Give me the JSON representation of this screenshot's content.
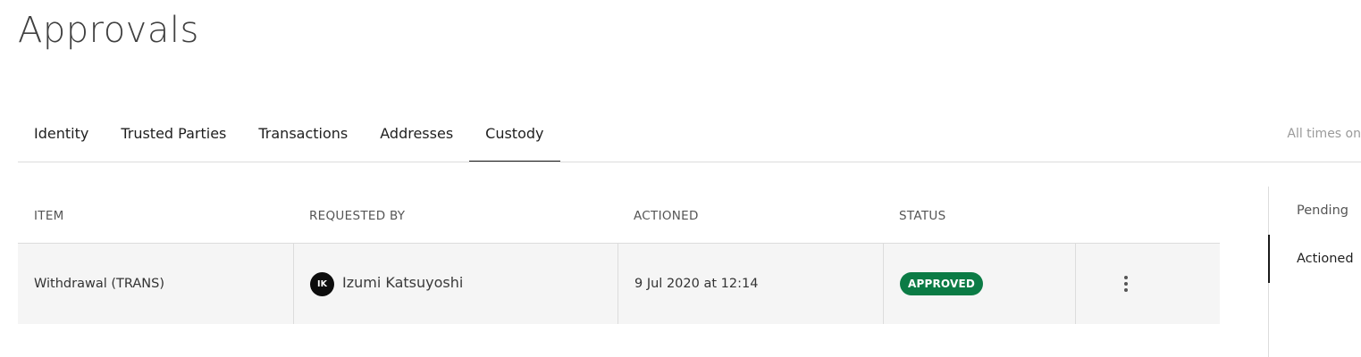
{
  "page": {
    "title": "Approvals"
  },
  "tabs": [
    {
      "label": "Identity",
      "active": false
    },
    {
      "label": "Trusted Parties",
      "active": false
    },
    {
      "label": "Transactions",
      "active": false
    },
    {
      "label": "Addresses",
      "active": false
    },
    {
      "label": "Custody",
      "active": true
    }
  ],
  "timezone_note": "All times on",
  "table": {
    "columns": [
      "ITEM",
      "REQUESTED BY",
      "ACTIONED",
      "STATUS",
      ""
    ],
    "rows": [
      {
        "item": "Withdrawal (TRANS)",
        "requested_by": {
          "initials": "IK",
          "name": "Izumi Katsuyoshi"
        },
        "actioned": "9 Jul 2020 at 12:14",
        "status": "APPROVED",
        "status_color": "#0b7b45",
        "actions_icon": "kebab-menu-icon"
      }
    ]
  },
  "side_nav": {
    "items": [
      {
        "label": "Pending",
        "active": false
      },
      {
        "label": "Actioned",
        "active": true
      }
    ]
  },
  "colors": {
    "accent": "#1a1a1a",
    "row_background": "#f5f5f5",
    "divider": "#dcdcdc",
    "approved": "#0b7b45"
  }
}
